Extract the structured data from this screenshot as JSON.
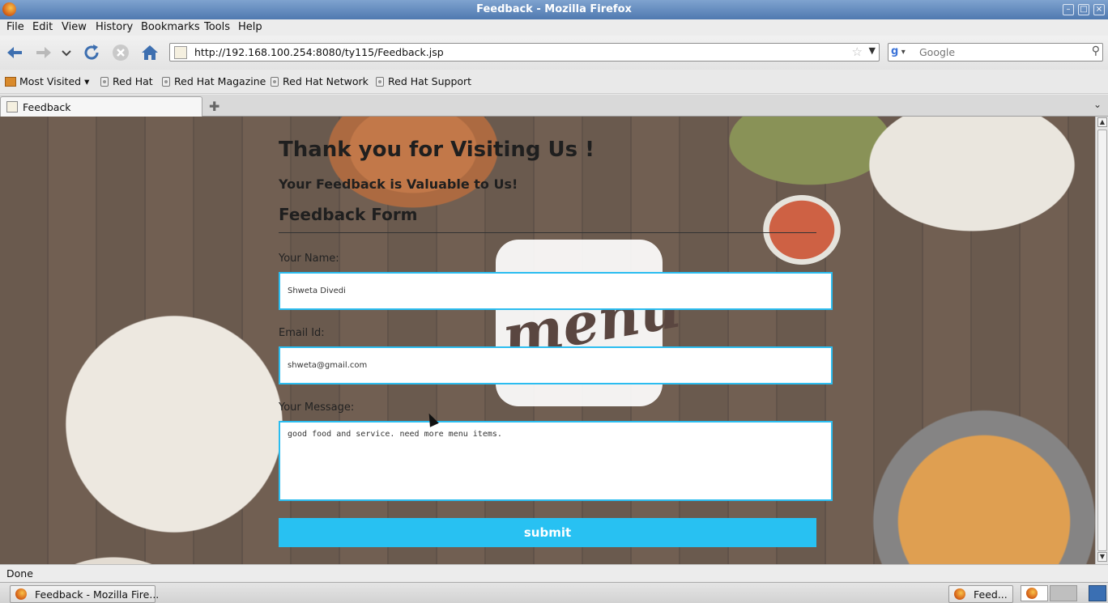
{
  "window": {
    "title": "Feedback - Mozilla Firefox",
    "controls": [
      "–",
      "□",
      "×"
    ]
  },
  "menu": [
    "File",
    "Edit",
    "View",
    "History",
    "Bookmarks",
    "Tools",
    "Help"
  ],
  "nav": {
    "url": "http://192.168.100.254:8080/ty115/Feedback.jsp",
    "search_placeholder": "Google",
    "search_engine": "g"
  },
  "bookmarks": {
    "most_visited": "Most Visited",
    "items": [
      "Red Hat",
      "Red Hat Magazine",
      "Red Hat Network",
      "Red Hat Support"
    ]
  },
  "tabs": [
    {
      "label": "Feedback"
    }
  ],
  "page": {
    "heading": "Thank you for Visiting Us !",
    "subheading": "Your Feedback is Valuable to Us!",
    "form_title": "Feedback Form",
    "name_label": "Your Name:",
    "name_value": "Shweta Divedi",
    "email_label": "Email Id:",
    "email_value": "shweta@gmail.com",
    "message_label": "Your Message:",
    "message_value": "good food and service. need more menu items.",
    "submit_label": "submit",
    "logo_text": "menu",
    "accent_color": "#28c1f2"
  },
  "status": {
    "text": "Done"
  },
  "taskbar": {
    "window_button": "Feedback - Mozilla Fire...",
    "tray_button": "Feed..."
  }
}
